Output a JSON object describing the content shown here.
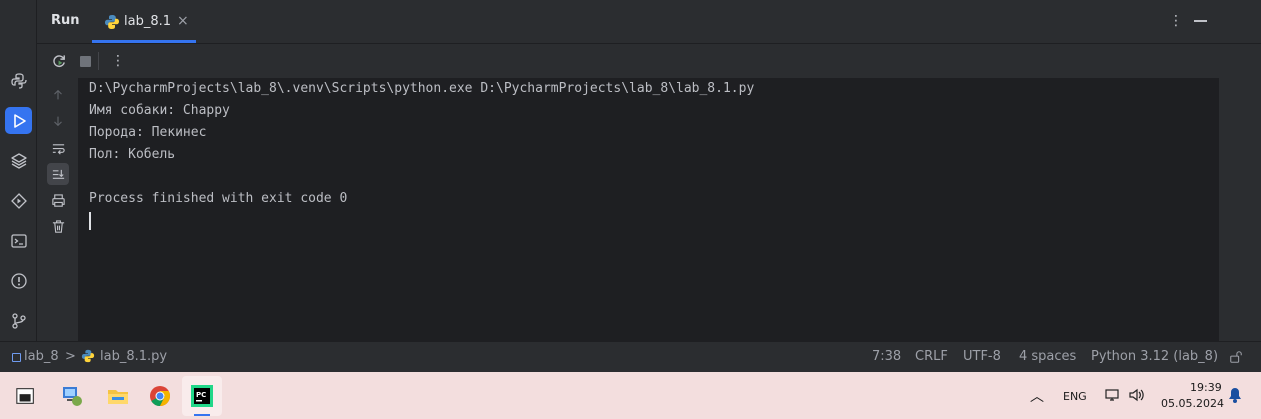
{
  "panel": {
    "title": "Run"
  },
  "tabs": [
    {
      "label": "lab_8.1",
      "close": "×",
      "icon": "python-file-icon"
    }
  ],
  "tabbar": {
    "more": "⋮"
  },
  "toolbar": {
    "more": "⋮"
  },
  "console": {
    "lines": [
      "D:\\PycharmProjects\\lab_8\\.venv\\Scripts\\python.exe D:\\PycharmProjects\\lab_8\\lab_8.1.py",
      "Имя собаки: Chappy",
      "Порода: Пекинес",
      "Пол: Кобель",
      "",
      "Process finished with exit code 0"
    ]
  },
  "breadcrumb": {
    "project": "lab_8",
    "separator": ">",
    "file": "lab_8.1.py"
  },
  "status": {
    "position": "7:38",
    "line_separator": "CRLF",
    "encoding": "UTF-8",
    "indent": "4 spaces",
    "interpreter": "Python 3.12 (lab_8)"
  },
  "taskbar": {
    "language": "ENG",
    "time": "19:39",
    "date": "05.05.2024"
  },
  "colors": {
    "accent": "#3574f0",
    "background": "#2b2d30",
    "console": "#1e1f22",
    "taskbar": "#f3dede"
  }
}
